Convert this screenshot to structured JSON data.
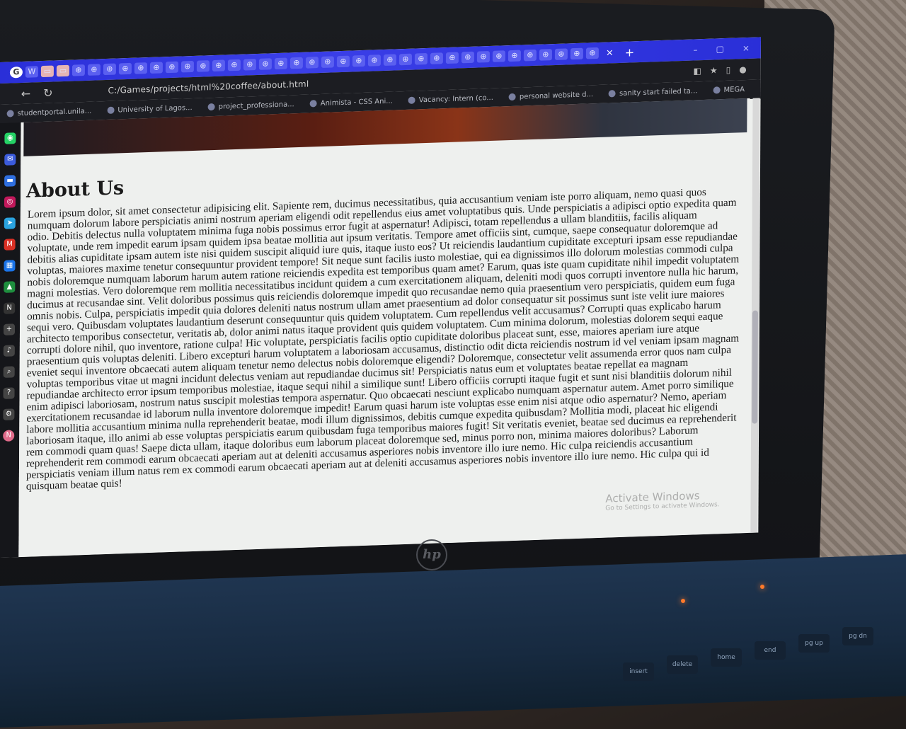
{
  "browser": {
    "tab_icons": [
      "G",
      "W",
      "▭",
      "▭",
      "⊕",
      "⊕",
      "⊕",
      "⊕",
      "⊕",
      "⊕",
      "⊕",
      "⊕",
      "⊕",
      "⊕",
      "⊕",
      "⊕",
      "⊕",
      "⊕",
      "⊕",
      "⊕",
      "⊕",
      "⊕",
      "⊕",
      "⊕",
      "⊕",
      "⊕",
      "⊕",
      "⊕",
      "⊕",
      "⊕",
      "⊕",
      "⊕",
      "⊕",
      "⊕",
      "⊕",
      "⊕",
      "⊕",
      "⊕"
    ],
    "tab_close": "×",
    "new_tab": "+",
    "window_controls": [
      "–",
      "▢",
      "×"
    ],
    "url": "C:/Games/projects/html%20coffee/about.html",
    "bookmarks": [
      "studentportal.unila...",
      "University of Lagos...",
      "project_professiona...",
      "Animista - CSS Ani...",
      "Vacancy: Intern (co...",
      "personal website d...",
      "sanity start failed ta...",
      "MEGA"
    ]
  },
  "page": {
    "heading": "About Us",
    "paragraph": "Lorem ipsum dolor, sit amet consectetur adipisicing elit. Sapiente rem, ducimus necessitatibus, quia accusantium veniam iste porro aliquam, nemo quasi quos numquam dolorum labore perspiciatis animi nostrum aperiam eligendi odit repellendus eius amet voluptatibus quis. Unde perspiciatis a adipisci optio expedita quam odio. Debitis delectus nulla voluptatem minima fuga nobis possimus error fugit at aspernatur! Adipisci, totam repellendus a ullam blanditiis, facilis aliquam voluptate, unde rem impedit earum ipsam quidem ipsa beatae mollitia aut ipsum veritatis. Tempore amet officiis sint, cumque, saepe consequatur doloremque ad debitis alias cupiditate ipsam autem iste nisi quidem suscipit aliquid iure quis, itaque iusto eos? Ut reiciendis laudantium cupiditate excepturi ipsam esse repudiandae voluptas, maiores maxime tenetur consequuntur provident tempore! Sit neque sunt facilis iusto molestiae, qui ea dignissimos illo dolorum molestias commodi culpa nobis doloremque numquam laborum harum autem ratione reiciendis expedita est temporibus quam amet? Earum, quas iste quam cupiditate nihil impedit voluptatem magni molestias. Vero doloremque rem mollitia necessitatibus incidunt quidem a cum exercitationem aliquam, deleniti modi quos corrupti inventore nulla hic harum, ducimus at recusandae sint. Velit doloribus possimus quis reiciendis doloremque impedit quo recusandae nemo quia praesentium vero perspiciatis, quidem eum fuga omnis nobis. Culpa, perspiciatis impedit quia dolores deleniti natus nostrum ullam amet praesentium ad dolor consequatur sit possimus sunt iste velit iure maiores sequi vero. Quibusdam voluptates laudantium deserunt consequuntur quis quidem voluptatem. Cum repellendus velit accusamus? Corrupti quas explicabo harum architecto temporibus consectetur, veritatis ab, dolor animi natus itaque provident quis quidem voluptatem. Cum minima dolorum, molestias dolorem sequi eaque corrupti dolore nihil, quo inventore, ratione culpa! Hic voluptate, perspiciatis facilis optio cupiditate doloribus placeat sunt, esse, maiores aperiam iure atque praesentium quis voluptas deleniti. Libero excepturi harum voluptatem a laboriosam accusamus, distinctio odit dicta reiciendis nostrum id vel veniam ipsam magnam eveniet sequi inventore obcaecati autem aliquam tenetur nemo delectus nobis doloremque eligendi? Doloremque, consectetur velit assumenda error quos nam culpa voluptas temporibus vitae ut magni incidunt delectus veniam aut repudiandae ducimus sit! Perspiciatis natus eum et voluptates beatae repellat ea magnam repudiandae architecto error ipsum temporibus molestiae, itaque sequi nihil a similique sunt! Libero officiis corrupti itaque fugit et sunt nisi blanditiis dolorum nihil enim adipisci laboriosam, nostrum natus suscipit molestias tempora aspernatur. Quo obcaecati nesciunt explicabo numquam aspernatur autem. Amet porro similique exercitationem recusandae id laborum nulla inventore doloremque impedit! Earum quasi harum iste voluptas esse enim nisi atque odio aspernatur? Nemo, aperiam labore mollitia accusantium minima nulla reprehenderit beatae, modi illum dignissimos, debitis cumque expedita quibusdam? Mollitia modi, placeat hic eligendi laboriosam itaque, illo animi ab esse voluptas perspiciatis earum quibusdam fuga temporibus maiores fugit! Sit veritatis eveniet, beatae sed ducimus ea reprehenderit rem commodi quam quas! Saepe dicta ullam, itaque doloribus eum laborum placeat doloremque sed, minus porro non, minima maiores doloribus? Laborum reprehenderit rem commodi earum obcaecati aperiam aut at deleniti accusamus asperiores nobis inventore illo iure nemo. Hic culpa reiciendis accusantium perspiciatis veniam illum natus rem ex commodi earum obcaecati aperiam aut at deleniti accusamus asperiores nobis inventore illo iure nemo. Hic culpa qui id quisquam beatae quis!"
  },
  "os": {
    "activate_title": "Activate Windows",
    "activate_sub": "Go to Settings to activate Windows."
  },
  "laptop": {
    "brand": "hp",
    "keys": [
      "insert",
      "delete",
      "home",
      "end",
      "pg up",
      "pg dn"
    ]
  },
  "colors": {
    "tab_bar": "#2a2fd8",
    "page_bg": "#eef0ee",
    "laptop_base": "#1f3550"
  }
}
